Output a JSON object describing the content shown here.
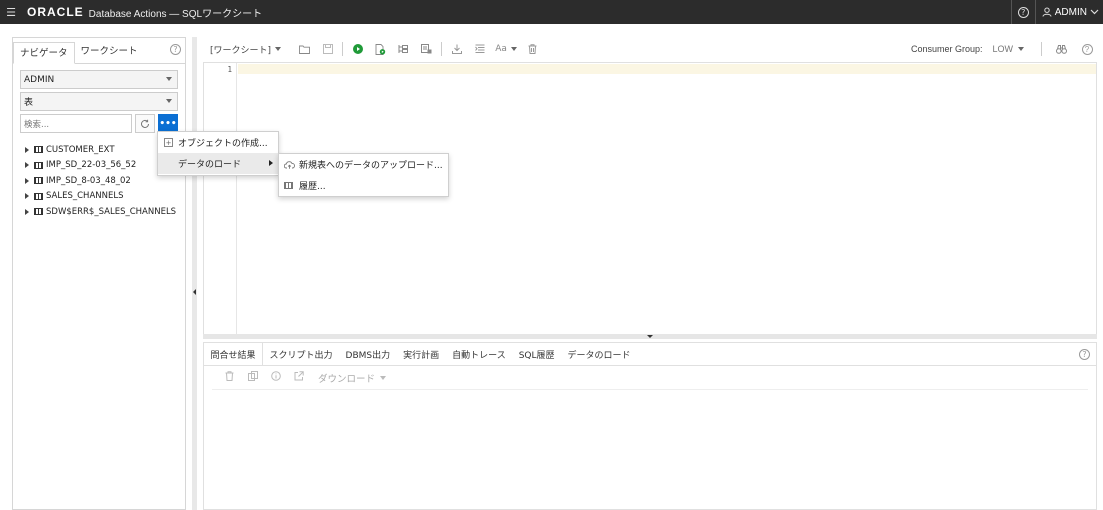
{
  "topbar": {
    "logo": "ORACLE",
    "title": "Database Actions — SQLワークシート",
    "user": "ADMIN"
  },
  "navigator": {
    "tabs": [
      {
        "label": "ナビゲータ",
        "active": true
      },
      {
        "label": "ワークシート",
        "active": false
      }
    ],
    "schema": "ADMIN",
    "object_type": "表",
    "search_placeholder": "検索...",
    "tree": [
      "CUSTOMER_EXT",
      "IMP_SD_22-03_56_52",
      "IMP_SD_8-03_48_02",
      "SALES_CHANNELS",
      "SDW$ERR$_SALES_CHANNELS"
    ]
  },
  "context_menu": {
    "items": [
      {
        "label": "オブジェクトの作成..."
      },
      {
        "label": "データのロード",
        "highlighted": true
      }
    ],
    "submenu": [
      {
        "label": "新規表へのデータのアップロード..."
      },
      {
        "label": "履歴..."
      }
    ]
  },
  "toolbar": {
    "worksheet_label": "[ワークシート]",
    "consumer_group_label": "Consumer Group:",
    "consumer_group_value": "LOW"
  },
  "editor": {
    "line_numbers": [
      "1"
    ]
  },
  "results": {
    "tabs": [
      "問合せ結果",
      "スクリプト出力",
      "DBMS出力",
      "実行計画",
      "自動トレース",
      "SQL履歴",
      "データのロード"
    ],
    "download_label": "ダウンロード"
  },
  "colors": {
    "topbar_bg": "#2c2c2c",
    "accent_blue": "#0b6fd3",
    "run_green": "#1f9a38",
    "current_line": "#fbf6e3"
  }
}
